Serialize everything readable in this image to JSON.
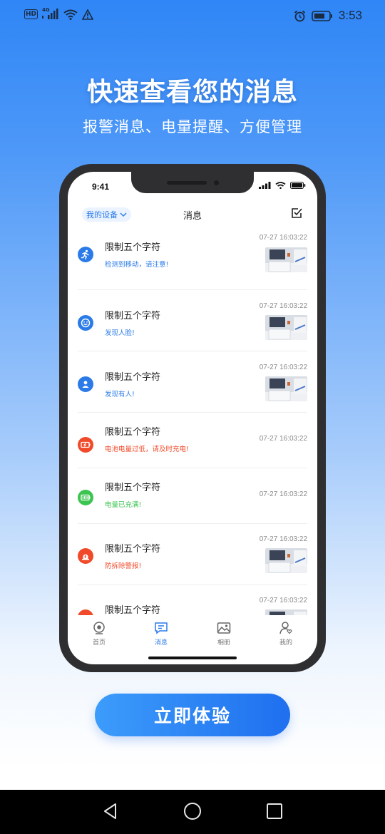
{
  "status_bar": {
    "network": "4G",
    "time": "3:53"
  },
  "headline": "快速查看您的消息",
  "subheadline": "报警消息、电量提醒、方便管理",
  "mock_phone": {
    "time": "9:41",
    "header": {
      "device_selector": "我的设备",
      "title": "消息"
    },
    "messages": [
      {
        "icon": "motion-icon",
        "icon_color": "#2a7ae8",
        "title": "限制五个字符",
        "desc": "检测到移动，请注意!",
        "desc_color": "#2a7ae8",
        "time": "07-27 16:03:22",
        "thumbnail": true
      },
      {
        "icon": "face-icon",
        "icon_color": "#2a7ae8",
        "title": "限制五个字符",
        "desc": "发现人脸!",
        "desc_color": "#2a7ae8",
        "time": "07-27 16:03:22",
        "thumbnail": true
      },
      {
        "icon": "person-icon",
        "icon_color": "#2a7ae8",
        "title": "限制五个字符",
        "desc": "发现有人!",
        "desc_color": "#2a7ae8",
        "time": "07-27 16:03:22",
        "thumbnail": true
      },
      {
        "icon": "battery-low-icon",
        "icon_color": "#f04a2a",
        "title": "限制五个字符",
        "desc": "电池电量过低，请及时充电!",
        "desc_color": "#f04a2a",
        "time": "07-27 16:03:22",
        "thumbnail": false
      },
      {
        "icon": "battery-full-icon",
        "icon_color": "#3cc451",
        "title": "限制五个字符",
        "desc": "电量已充满!",
        "desc_color": "#3cc451",
        "time": "07-27 16:03:22",
        "thumbnail": false
      },
      {
        "icon": "tamper-alarm-icon",
        "icon_color": "#f04a2a",
        "title": "限制五个字符",
        "desc": "防拆除警报!",
        "desc_color": "#f04a2a",
        "time": "07-27 16:03:22",
        "thumbnail": true
      },
      {
        "icon": "tamper-alarm-icon",
        "icon_color": "#f04a2a",
        "title": "限制五个字符",
        "desc": "",
        "desc_color": "#f04a2a",
        "time": "07-27 16:03:22",
        "thumbnail": true
      }
    ],
    "tabs": [
      {
        "label": "首页",
        "icon": "home-icon",
        "active": false
      },
      {
        "label": "消息",
        "icon": "message-icon",
        "active": true
      },
      {
        "label": "相册",
        "icon": "album-icon",
        "active": false
      },
      {
        "label": "我的",
        "icon": "profile-icon",
        "active": false
      }
    ]
  },
  "cta_label": "立即体验",
  "colors": {
    "accent": "#2a7ae8",
    "alert": "#f04a2a",
    "success": "#3cc451"
  }
}
